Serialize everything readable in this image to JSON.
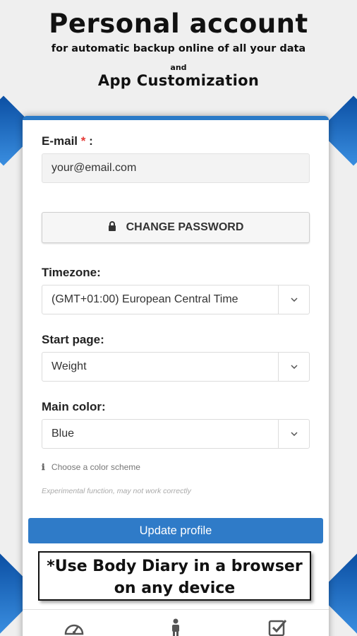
{
  "hero": {
    "title": "Personal account",
    "subtitle": "for automatic backup online of all your data",
    "and": "and",
    "app_customization": "App Customization"
  },
  "form": {
    "email_label": "E-mail",
    "required_mark": "*",
    "email_colon": ":",
    "email_value": "your@email.com",
    "change_password_label": "CHANGE PASSWORD",
    "timezone_label": "Timezone:",
    "timezone_value": "(GMT+01:00) European Central Time",
    "start_page_label": "Start page:",
    "start_page_value": "Weight",
    "main_color_label": "Main color:",
    "main_color_value": "Blue",
    "color_hint": "Choose a color scheme",
    "experimental_note": "Experimental function, may not work correctly",
    "update_button": "Update profile"
  },
  "note": {
    "line1": "*Use Body Diary in a browser",
    "line2": "on any device"
  },
  "tabbar": {
    "icons": [
      "dashboard-icon",
      "person-icon",
      "checkbox-icon"
    ]
  },
  "colors": {
    "accent": "#2f7bc8",
    "required": "#e53935",
    "background": "#efefef"
  }
}
